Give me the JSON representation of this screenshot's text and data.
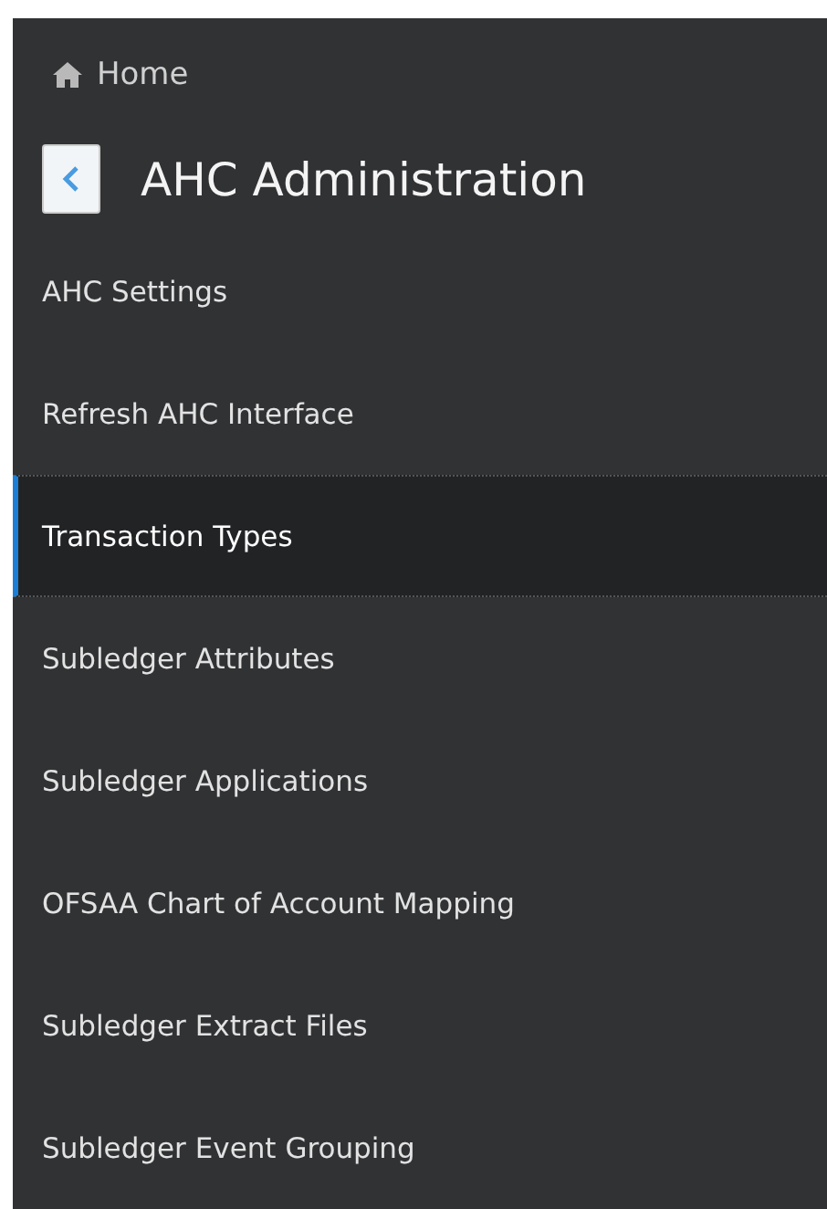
{
  "breadcrumb": {
    "label": "Home"
  },
  "header": {
    "title": "AHC Administration"
  },
  "menu": [
    {
      "label": "AHC Settings",
      "selected": false
    },
    {
      "label": "Refresh AHC Interface",
      "selected": false
    },
    {
      "label": "Transaction Types",
      "selected": true
    },
    {
      "label": "Subledger Attributes",
      "selected": false
    },
    {
      "label": "Subledger Applications",
      "selected": false
    },
    {
      "label": "OFSAA Chart of Account Mapping",
      "selected": false
    },
    {
      "label": "Subledger Extract Files",
      "selected": false
    },
    {
      "label": "Subledger Event Grouping",
      "selected": false
    }
  ]
}
